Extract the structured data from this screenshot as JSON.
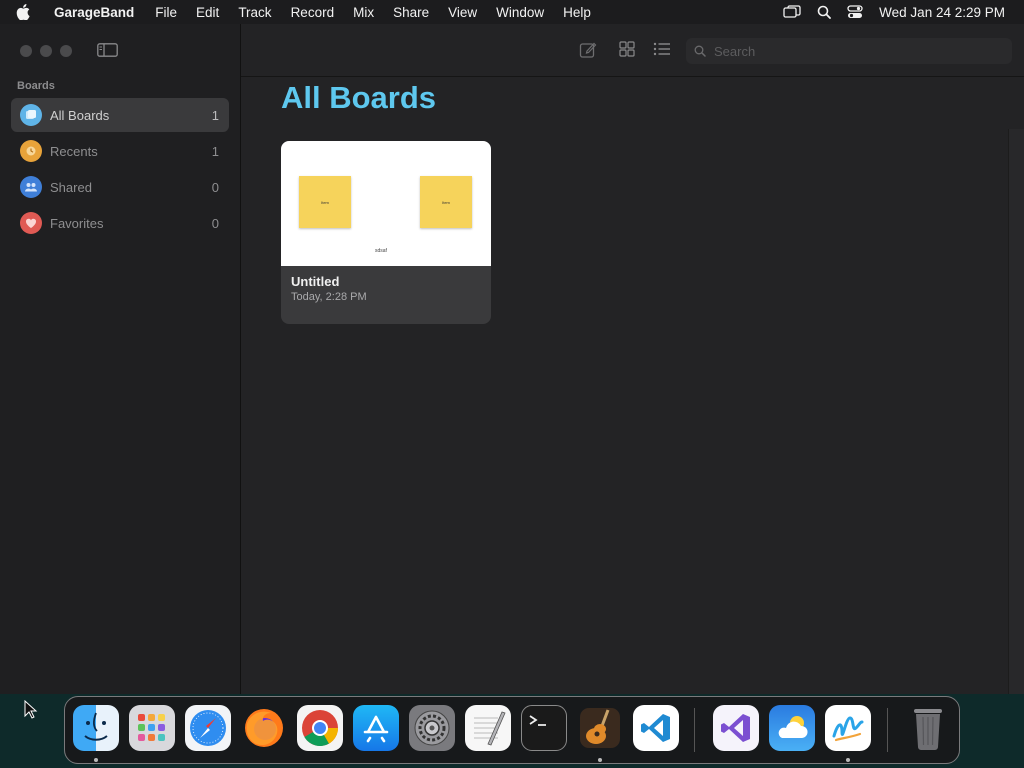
{
  "menubar": {
    "app_name": "GarageBand",
    "items": [
      "File",
      "Edit",
      "Track",
      "Record",
      "Mix",
      "Share",
      "View",
      "Window",
      "Help"
    ],
    "clock": "Wed Jan 24  2:29 PM"
  },
  "sidebar": {
    "section_label": "Boards",
    "items": [
      {
        "label": "All Boards",
        "count": "1",
        "icon": "all-boards-icon",
        "color": "#5fb4e8"
      },
      {
        "label": "Recents",
        "count": "1",
        "icon": "clock-icon",
        "color": "#e8a33a"
      },
      {
        "label": "Shared",
        "count": "0",
        "icon": "people-icon",
        "color": "#3f7fd8"
      },
      {
        "label": "Favorites",
        "count": "0",
        "icon": "heart-icon",
        "color": "#e05a54"
      }
    ]
  },
  "toolbar": {
    "search_placeholder": "Search"
  },
  "main": {
    "title": "All Boards",
    "title_color": "#5ec8ef",
    "boards": [
      {
        "title": "Untitled",
        "date": "Today, 2:28 PM",
        "thumb_notes": [
          "Item",
          "Item"
        ],
        "thumb_text": "sdsaf"
      }
    ]
  },
  "dock": {
    "apps": [
      "Finder",
      "Launchpad",
      "Safari",
      "Firefox",
      "Chrome",
      "App Store",
      "System Settings",
      "TextEdit",
      "Terminal",
      "GarageBand",
      "Visual Studio Code",
      "Visual Studio",
      "Weather",
      "Freeform",
      "Trash"
    ]
  }
}
